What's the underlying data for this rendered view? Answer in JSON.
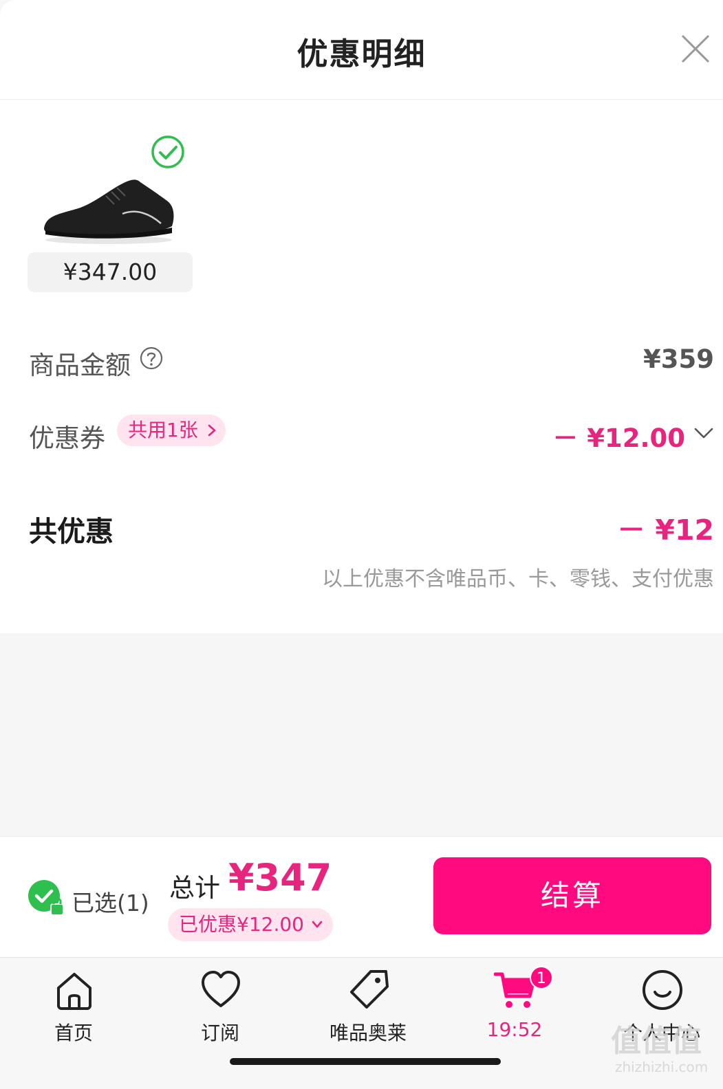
{
  "header": {
    "title": "优惠明细"
  },
  "product": {
    "price": "¥347.00"
  },
  "rows": {
    "goods_amount": {
      "label": "商品金额",
      "value": "¥359"
    },
    "coupon": {
      "label": "优惠券",
      "tag": "共用1张",
      "value": "－ ¥12.00"
    },
    "total_discount": {
      "label": "共优惠",
      "value": "－ ¥12"
    },
    "note": "以上优惠不含唯品币、卡、零钱、支付优惠"
  },
  "checkout": {
    "selected_label": "已选(1)",
    "sum_label": "总计",
    "sum_value": "¥347",
    "discount_label": "已优惠¥12.00",
    "pay_button": "结算"
  },
  "tabbar": {
    "tabs": [
      {
        "label": "首页",
        "icon": "home-icon"
      },
      {
        "label": "订阅",
        "icon": "heart-icon"
      },
      {
        "label": "唯品奥莱",
        "icon": "tag-icon"
      },
      {
        "label": "19:52",
        "icon": "cart-icon",
        "badge": "1"
      },
      {
        "label": "个人中心",
        "icon": "smiley-icon"
      }
    ]
  },
  "watermark": {
    "text": "值值值",
    "url": "zhizhizhi.com"
  },
  "colors": {
    "accent": "#ff0a7f",
    "accent_text": "#e8257e",
    "check_green": "#2fbf4e"
  }
}
